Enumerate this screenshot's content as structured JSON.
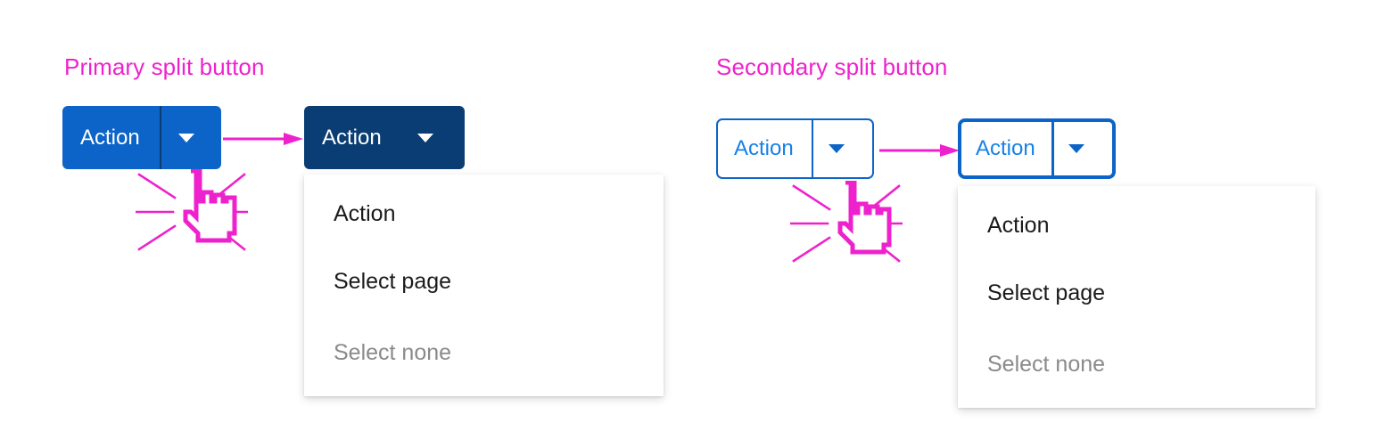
{
  "colors": {
    "accent_magenta": "#ee22cc",
    "primary_blue": "#0c64c8",
    "primary_blue_active": "#0a3d73",
    "secondary_text_blue": "#1681e8",
    "menu_text": "#1a1a1a",
    "menu_text_disabled": "#8a8a8a",
    "page_background": "#ffffff"
  },
  "primary": {
    "title": "Primary split button",
    "default_button": {
      "label": "Action",
      "caret_icon": "chevron-down-icon"
    },
    "active_button": {
      "label": "Action",
      "caret_icon": "chevron-down-icon"
    },
    "arrow_icon": "arrow-right-icon",
    "cursor_icon": "pointing-hand-cursor-icon",
    "menu": {
      "items": [
        {
          "label": "Action",
          "disabled": false
        },
        {
          "label": "Select page",
          "disabled": false
        },
        {
          "label": "Select none",
          "disabled": true
        }
      ]
    }
  },
  "secondary": {
    "title": "Secondary split button",
    "default_button": {
      "label": "Action",
      "caret_icon": "chevron-down-icon"
    },
    "active_button": {
      "label": "Action",
      "caret_icon": "chevron-down-icon"
    },
    "arrow_icon": "arrow-right-icon",
    "cursor_icon": "pointing-hand-cursor-icon",
    "menu": {
      "items": [
        {
          "label": "Action",
          "disabled": false
        },
        {
          "label": "Select page",
          "disabled": false
        },
        {
          "label": "Select none",
          "disabled": true
        }
      ]
    }
  }
}
